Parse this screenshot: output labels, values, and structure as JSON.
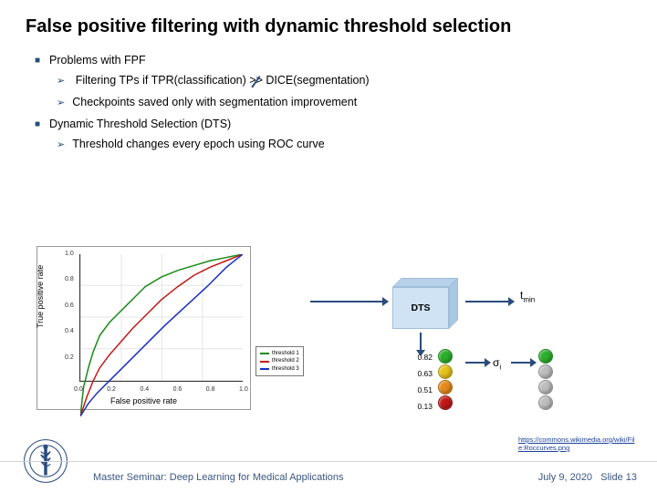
{
  "title": "False positive filtering with dynamic threshold selection",
  "bullets": {
    "problems": "Problems with FPF",
    "b1a": "Filtering TPs if TPR(classification) ",
    "b1_gt": ">>",
    "b1b": " DICE(segmentation)",
    "b2": "Checkpoints saved only with segmentation improvement",
    "dts": "Dynamic Threshold Selection (DTS)",
    "b3": "Threshold changes every epoch using ROC curve"
  },
  "chart_data": {
    "type": "line",
    "title": "",
    "xlabel": "False positive rate",
    "ylabel": "True positive rate",
    "xlim": [
      0,
      1
    ],
    "ylim": [
      0,
      1
    ],
    "xticks": [
      "0.0",
      "0.2",
      "0.4",
      "0.6",
      "0.8",
      "1.0"
    ],
    "yticks": [
      "0.2",
      "0.4",
      "0.6",
      "0.8",
      "1.0"
    ],
    "series": [
      {
        "name": "threshold 1",
        "color": "#1a8a1a",
        "x": [
          0,
          0.02,
          0.05,
          0.08,
          0.12,
          0.18,
          0.22,
          0.28,
          0.34,
          0.4,
          0.5,
          0.6,
          0.7,
          0.8,
          0.9,
          1.0
        ],
        "y": [
          0,
          0.18,
          0.3,
          0.4,
          0.5,
          0.58,
          0.62,
          0.68,
          0.74,
          0.8,
          0.86,
          0.9,
          0.93,
          0.96,
          0.98,
          1.0
        ]
      },
      {
        "name": "threshold 2",
        "color": "#c21818",
        "x": [
          0,
          0.04,
          0.08,
          0.12,
          0.18,
          0.25,
          0.32,
          0.4,
          0.5,
          0.6,
          0.7,
          0.8,
          0.9,
          1.0
        ],
        "y": [
          0,
          0.12,
          0.22,
          0.3,
          0.38,
          0.46,
          0.54,
          0.62,
          0.72,
          0.8,
          0.87,
          0.92,
          0.96,
          1.0
        ]
      },
      {
        "name": "threshold 3",
        "color": "#1830c2",
        "x": [
          0,
          0.05,
          0.1,
          0.18,
          0.28,
          0.4,
          0.52,
          0.65,
          0.78,
          0.9,
          1.0
        ],
        "y": [
          0,
          0.08,
          0.14,
          0.22,
          0.32,
          0.44,
          0.56,
          0.68,
          0.8,
          0.92,
          1.0
        ]
      }
    ]
  },
  "dts_box": "DTS",
  "tmin": {
    "t": "t",
    "sub": "min"
  },
  "sigma": {
    "s": "σ",
    "sub": "i"
  },
  "thresholds": {
    "values": [
      "0.82",
      "0.63",
      "0.51",
      "0.13"
    ],
    "colors_on": [
      "#2bb02b",
      "#e6c21a",
      "#e68a1a",
      "#c21818"
    ],
    "colors_off": [
      "#bdbdbd",
      "#bdbdbd",
      "#bdbdbd",
      "#bdbdbd"
    ],
    "highlight_index": 0
  },
  "link": "https://commons.wikimedia.org/wiki/File:Roccurves.png",
  "footer": {
    "left": "Master Seminar: Deep Learning for Medical Applications",
    "date": "July 9, 2020",
    "slide": "Slide 13"
  }
}
